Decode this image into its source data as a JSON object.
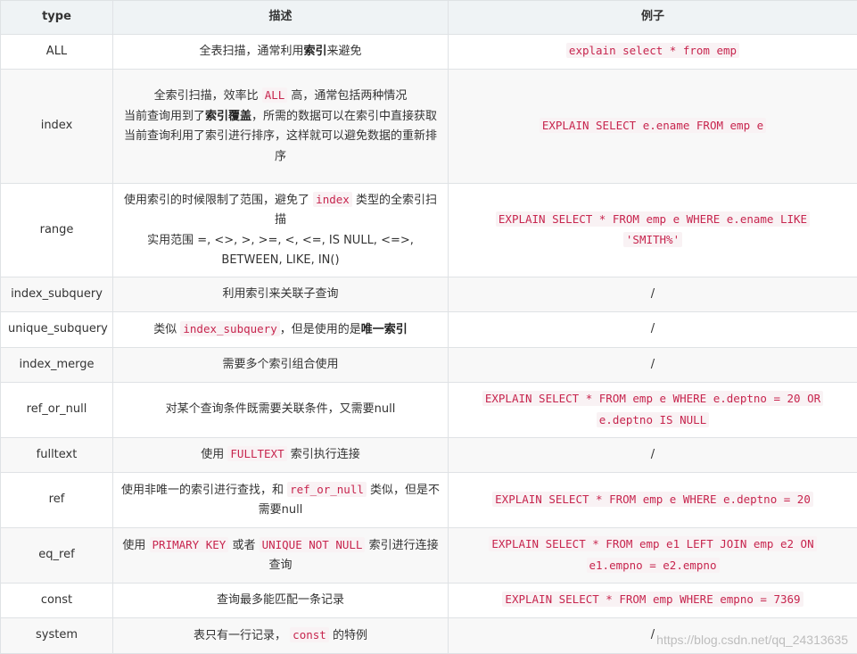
{
  "headers": [
    "type",
    "描述",
    "例子"
  ],
  "rows": [
    {
      "height": 39,
      "type": "ALL",
      "desc": [
        [
          {
            "t": "全表扫描，通常利用"
          },
          {
            "t": "索引",
            "b": true
          },
          {
            "t": "来避免"
          }
        ]
      ],
      "example": [
        "explain select * from emp"
      ]
    },
    {
      "height": 128,
      "type": "index",
      "desc": [
        [
          {
            "t": "全索引扫描，效率比 "
          },
          {
            "t": "ALL",
            "c": true
          },
          {
            "t": " 高，通常包括两种情况"
          }
        ],
        [
          {
            "t": "当前查询用到了"
          },
          {
            "t": "索引覆盖",
            "b": true
          },
          {
            "t": "，所需的数据可以在索引中直接获取"
          }
        ],
        [
          {
            "t": "当前查询利用了索引进行排序，这样就可以避免数据的重新排序"
          }
        ]
      ],
      "example": [
        "EXPLAIN SELECT e.ename FROM emp e"
      ]
    },
    {
      "height": 105,
      "type": "range",
      "desc": [
        [
          {
            "t": "使用索引的时候限制了范围，避免了 "
          },
          {
            "t": "index",
            "c": true
          },
          {
            "t": " 类型的全索引扫描"
          }
        ],
        [
          {
            "t": "实用范围 =, <>, >, >=, <, <=, IS NULL, <=>, BETWEEN, LIKE, IN()"
          }
        ]
      ],
      "example": [
        "EXPLAIN SELECT * FROM emp e WHERE e.ename LIKE",
        "'SMITH%'"
      ]
    },
    {
      "height": 39,
      "type": "index_subquery",
      "desc": [
        [
          {
            "t": "利用索引来关联子查询"
          }
        ]
      ],
      "example_plain": "/"
    },
    {
      "height": 40,
      "type": "unique_subquery",
      "desc": [
        [
          {
            "t": "类似 "
          },
          {
            "t": "index_subquery",
            "c": true
          },
          {
            "t": "，但是使用的是"
          },
          {
            "t": "唯一索引",
            "b": true
          }
        ]
      ],
      "example_plain": "/"
    },
    {
      "height": 39,
      "type": "index_merge",
      "desc": [
        [
          {
            "t": "需要多个索引组合使用"
          }
        ]
      ],
      "example_plain": "/"
    },
    {
      "height": 62,
      "type": "ref_or_null",
      "desc": [
        [
          {
            "t": "对某个查询条件既需要关联条件，又需要null"
          }
        ]
      ],
      "example": [
        "EXPLAIN SELECT * FROM emp e WHERE e.deptno = 20 OR",
        "e.deptno IS NULL"
      ]
    },
    {
      "height": 39,
      "type": "fulltext",
      "desc": [
        [
          {
            "t": "使用 "
          },
          {
            "t": "FULLTEXT",
            "c": true
          },
          {
            "t": " 索引执行连接"
          }
        ]
      ],
      "example_plain": "/"
    },
    {
      "height": 62,
      "type": "ref",
      "desc": [
        [
          {
            "t": "使用非唯一的索引进行查找，和 "
          },
          {
            "t": "ref_or_null",
            "c": true
          },
          {
            "t": " 类似，但是不需要null"
          }
        ]
      ],
      "example": [
        "EXPLAIN SELECT * FROM emp e WHERE e.deptno = 20"
      ]
    },
    {
      "height": 62,
      "type": "eq_ref",
      "desc": [
        [
          {
            "t": "使用 "
          },
          {
            "t": "PRIMARY KEY",
            "c": true
          },
          {
            "t": " 或者 "
          },
          {
            "t": "UNIQUE NOT NULL",
            "c": true
          },
          {
            "t": " 索引进行连接查询"
          }
        ]
      ],
      "example": [
        "EXPLAIN SELECT * FROM emp e1 LEFT JOIN emp e2 ON",
        "e1.empno = e2.empno"
      ]
    },
    {
      "height": 39,
      "type": "const",
      "desc": [
        [
          {
            "t": "查询最多能匹配一条记录"
          }
        ]
      ],
      "example": [
        "EXPLAIN SELECT * FROM emp WHERE empno = 7369"
      ]
    },
    {
      "height": 40,
      "type": "system",
      "desc": [
        [
          {
            "t": "表只有一行记录， "
          },
          {
            "t": "const",
            "c": true
          },
          {
            "t": " 的特例"
          }
        ]
      ],
      "example_plain": "/"
    }
  ],
  "watermark": "https://blog.csdn.net/qq_24313635"
}
